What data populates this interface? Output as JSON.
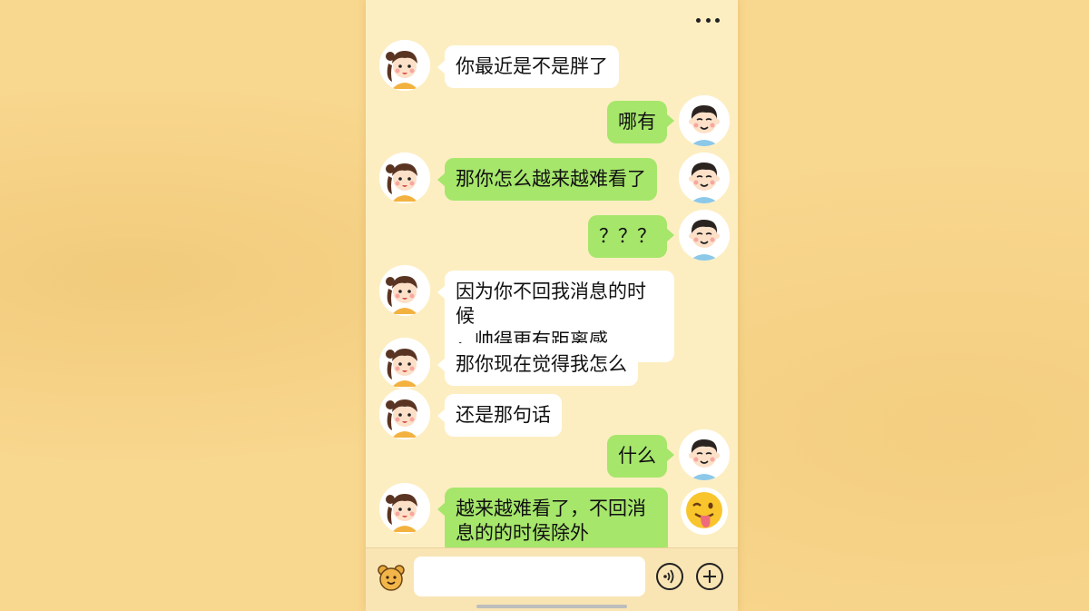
{
  "header": {
    "more_icon": "more-dots-icon"
  },
  "messages": [
    {
      "side": "left",
      "sender": "girl",
      "text": "你最近是不是胖了",
      "bubble": "white"
    },
    {
      "side": "right",
      "sender": "boy",
      "text": "哪有",
      "bubble": "green"
    },
    {
      "side": "left",
      "sender": "girl",
      "text": "那你怎么越来越难看了",
      "bubble": "green"
    },
    {
      "side": "right",
      "sender": "boy",
      "text": "？？？",
      "bubble": "green"
    },
    {
      "side": "left",
      "sender": "girl",
      "text": "因为你不回我消息的时候\n，帅得更有距离感",
      "bubble": "white"
    },
    {
      "side": "left",
      "sender": "girl",
      "text": "那你现在觉得我怎么",
      "bubble": "white"
    },
    {
      "side": "left",
      "sender": "girl",
      "text": "还是那句话",
      "bubble": "white"
    },
    {
      "side": "right",
      "sender": "boy",
      "text": "什么",
      "bubble": "green"
    },
    {
      "side": "left",
      "sender": "girl",
      "text": "越来越难看了，不回消\n息的的时侯除外",
      "bubble": "green",
      "trailing_emoji": "tongue-wink-emoji-icon"
    }
  ],
  "input_bar": {
    "emoji_icon": "bear-emoji-icon",
    "input_value": "",
    "voice_icon": "voice-icon",
    "plus_icon": "plus-icon"
  },
  "colors": {
    "background": "#f8d78e",
    "chat_bg": "#fdeec2",
    "green_bubble": "#a6e66b",
    "white_bubble": "#ffffff"
  }
}
